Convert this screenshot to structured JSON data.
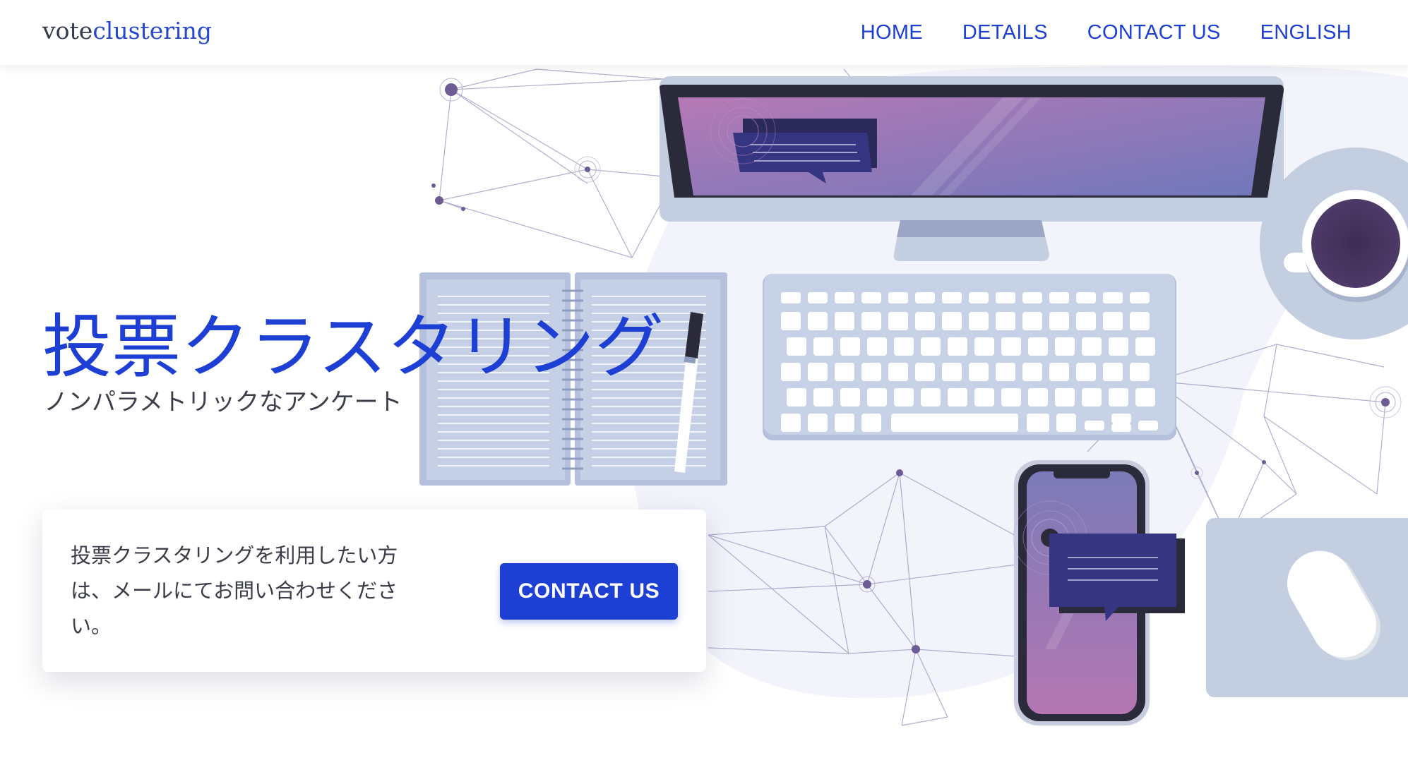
{
  "logo": {
    "part1": "vote",
    "part2": "clustering"
  },
  "nav": {
    "home": "HOME",
    "details": "DETAILS",
    "contact": "CONTACT US",
    "english": "ENGLISH"
  },
  "hero": {
    "title": "投票クラスタリング",
    "subtitle": "ノンパラメトリックなアンケート"
  },
  "cta": {
    "message": "投票クラスタリングを利用したい方は、メールにてお問い合わせください。",
    "button_label": "CONTACT US"
  },
  "colors": {
    "accent": "#1d3fd4",
    "text": "#3a3d48",
    "illustration_light": "#c3cee0",
    "screen_dark": "#2b2a3a"
  }
}
